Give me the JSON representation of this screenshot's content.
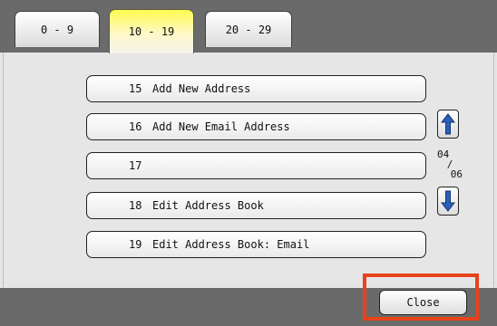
{
  "tabs": [
    {
      "label": "0 - 9"
    },
    {
      "label": "10 - 19"
    },
    {
      "label": "20 - 29"
    }
  ],
  "active_tab": "10 - 19",
  "items": [
    {
      "number": "15",
      "label": "Add New Address"
    },
    {
      "number": "16",
      "label": "Add New Email Address"
    },
    {
      "number": "17",
      "label": ""
    },
    {
      "number": "18",
      "label": "Edit Address Book"
    },
    {
      "number": "19",
      "label": "Edit Address Book: Email"
    }
  ],
  "pagination": {
    "current": "04",
    "separator": "/",
    "total": "06"
  },
  "footer": {
    "close_label": "Close"
  },
  "colors": {
    "active_tab": "#fffb4e",
    "bar": "#6a6a6a",
    "arrow": "#2a5fb8",
    "highlight": "#e8421c"
  },
  "icons": {
    "scroll_up": "arrow-up-icon",
    "scroll_down": "arrow-down-icon"
  }
}
